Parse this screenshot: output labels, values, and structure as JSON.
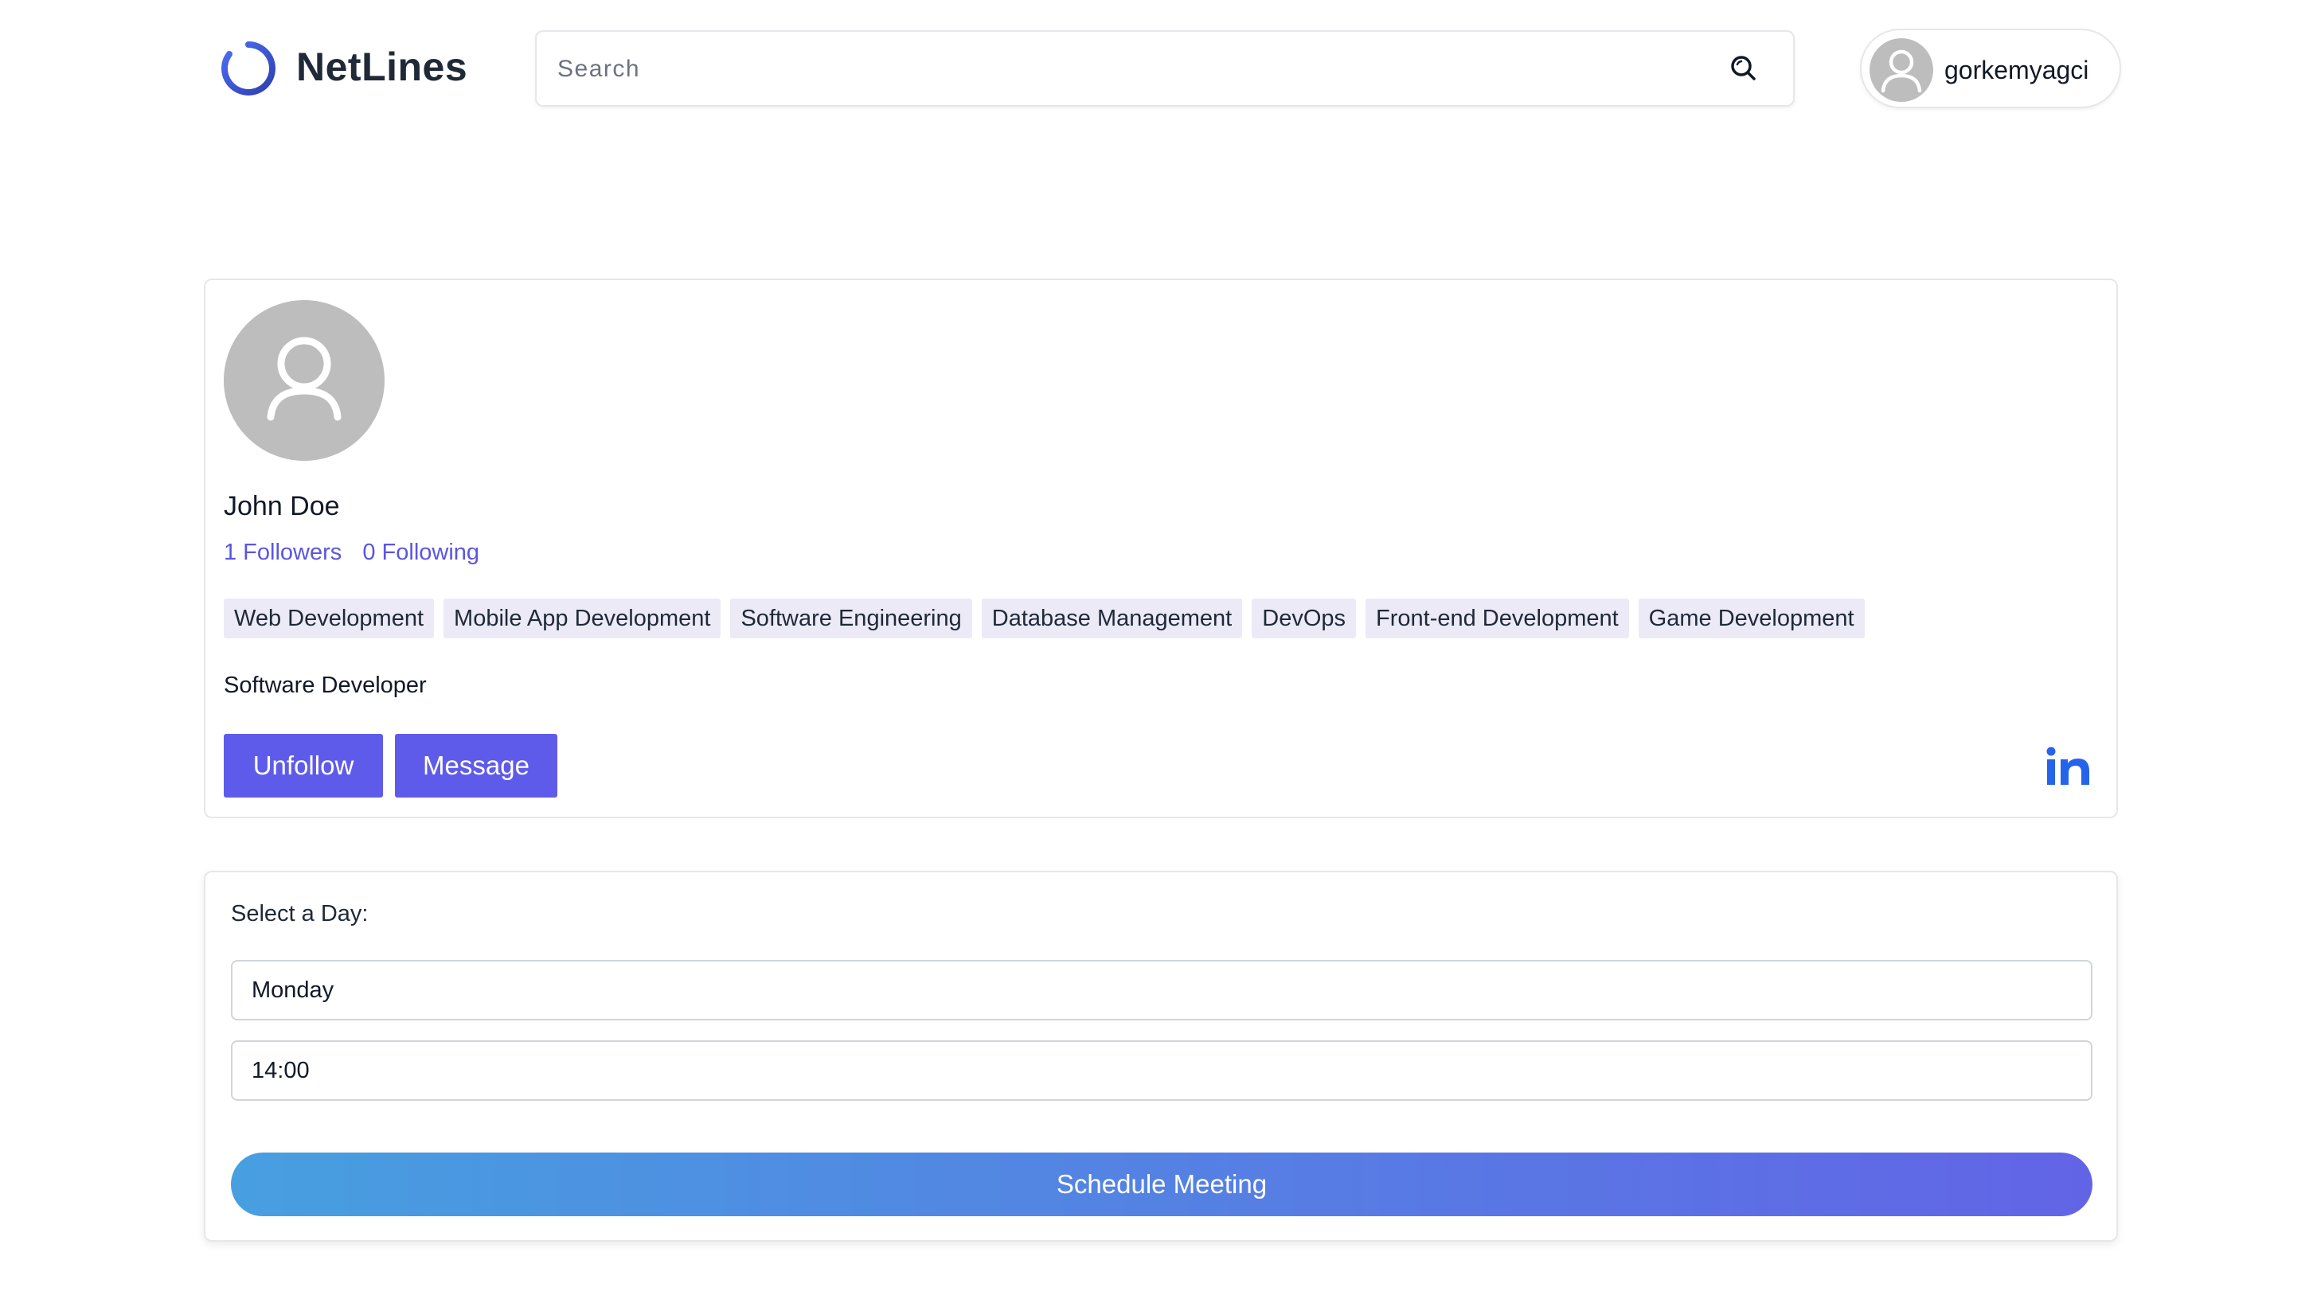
{
  "brand": {
    "name": "NetLines",
    "accent": "#3b5bdb"
  },
  "search": {
    "placeholder": "Search",
    "value": ""
  },
  "user": {
    "username": "gorkemyagci"
  },
  "profile": {
    "name": "John Doe",
    "followers": "1 Followers",
    "following": "0 Following",
    "tags": [
      "Web Development",
      "Mobile App Development",
      "Software Engineering",
      "Database Management",
      "DevOps",
      "Front-end Development",
      "Game Development"
    ],
    "role": "Software Developer",
    "unfollow_label": "Unfollow",
    "message_label": "Message",
    "social_icon": "linkedin-icon",
    "button_color": "#5f5bea",
    "link_color": "#5b55e0"
  },
  "schedule": {
    "label": "Select a Day:",
    "day_value": "Monday",
    "time_value": "14:00",
    "button_label": "Schedule Meeting",
    "gradient_start": "#479fe0",
    "gradient_end": "#6264e6"
  }
}
